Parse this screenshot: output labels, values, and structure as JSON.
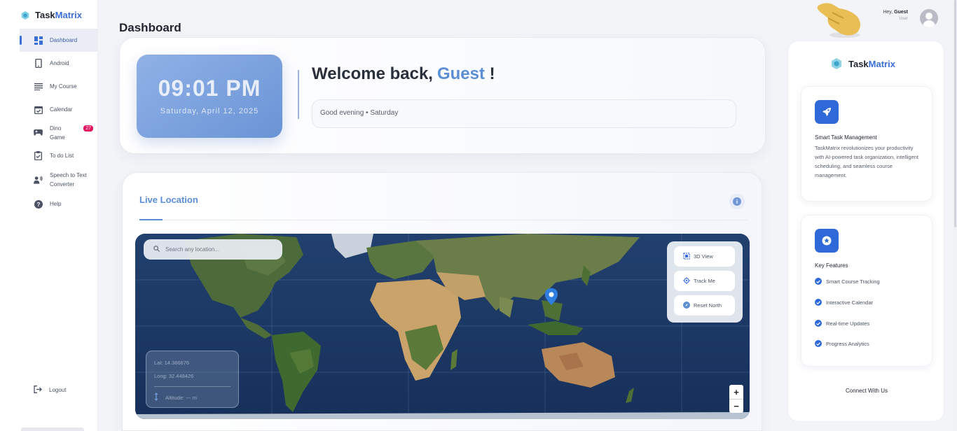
{
  "app": {
    "brand_part1": "Task",
    "brand_part2": "Matrix"
  },
  "sidebar": {
    "items": [
      {
        "label": "Dashboard",
        "icon": "dashboard-icon",
        "active": true
      },
      {
        "label": "Android",
        "icon": "phone-icon"
      },
      {
        "label": "My Course",
        "icon": "lines-icon"
      },
      {
        "label": "Calendar",
        "icon": "calendar-icon"
      },
      {
        "label": "Dino Game",
        "icon": "gamepad-icon",
        "badge": "27"
      },
      {
        "label": "To do List",
        "icon": "clipboard-icon"
      },
      {
        "label": "Speech to Text Converter",
        "icon": "speaker-person-icon"
      },
      {
        "label": "Help",
        "icon": "help-icon"
      }
    ],
    "logout_label": "Logout"
  },
  "header": {
    "title": "Dashboard",
    "greeting_prefix": "Hey, ",
    "user_name": "Guest",
    "user_role": "User"
  },
  "welcome": {
    "time": "09:01 PM",
    "date": "Saturday, April 12, 2025",
    "headline": "Welcome back,",
    "name": "Guest",
    "suffix": "!",
    "subtitle": "Good evening • Saturday"
  },
  "location": {
    "title": "Live Location",
    "search_placeholder": "Search any location...",
    "controls": [
      {
        "label": "3D View",
        "icon": "cube-icon"
      },
      {
        "label": "Track Me",
        "icon": "crosshair-icon"
      },
      {
        "label": "Reset North",
        "icon": "compass-icon"
      }
    ],
    "lat": "Lat: 14.366676",
    "lng": "Long: 32.448426",
    "altitude": "Altitude: --- m",
    "zoom_in": "+",
    "zoom_out": "−",
    "map_labels": {
      "nameless": ""
    }
  },
  "right_panel": {
    "brand_part1": "Task",
    "brand_part2": "Matrix",
    "card1_title": "Smart Task Management",
    "card1_text": "TaskMatrix revolutionizes your productivity with AI-powered task organization, intelligent scheduling, and seamless course management.",
    "card2_title": "Key Features",
    "features": [
      "Smart Course Tracking",
      "Interactive Calendar",
      "Real-time Updates",
      "Progress Analytics"
    ],
    "connect": "Connect With Us"
  },
  "colors": {
    "accent": "#3b6fd8",
    "clock_bg": "#7fa3dd",
    "badge": "#e5135f"
  }
}
